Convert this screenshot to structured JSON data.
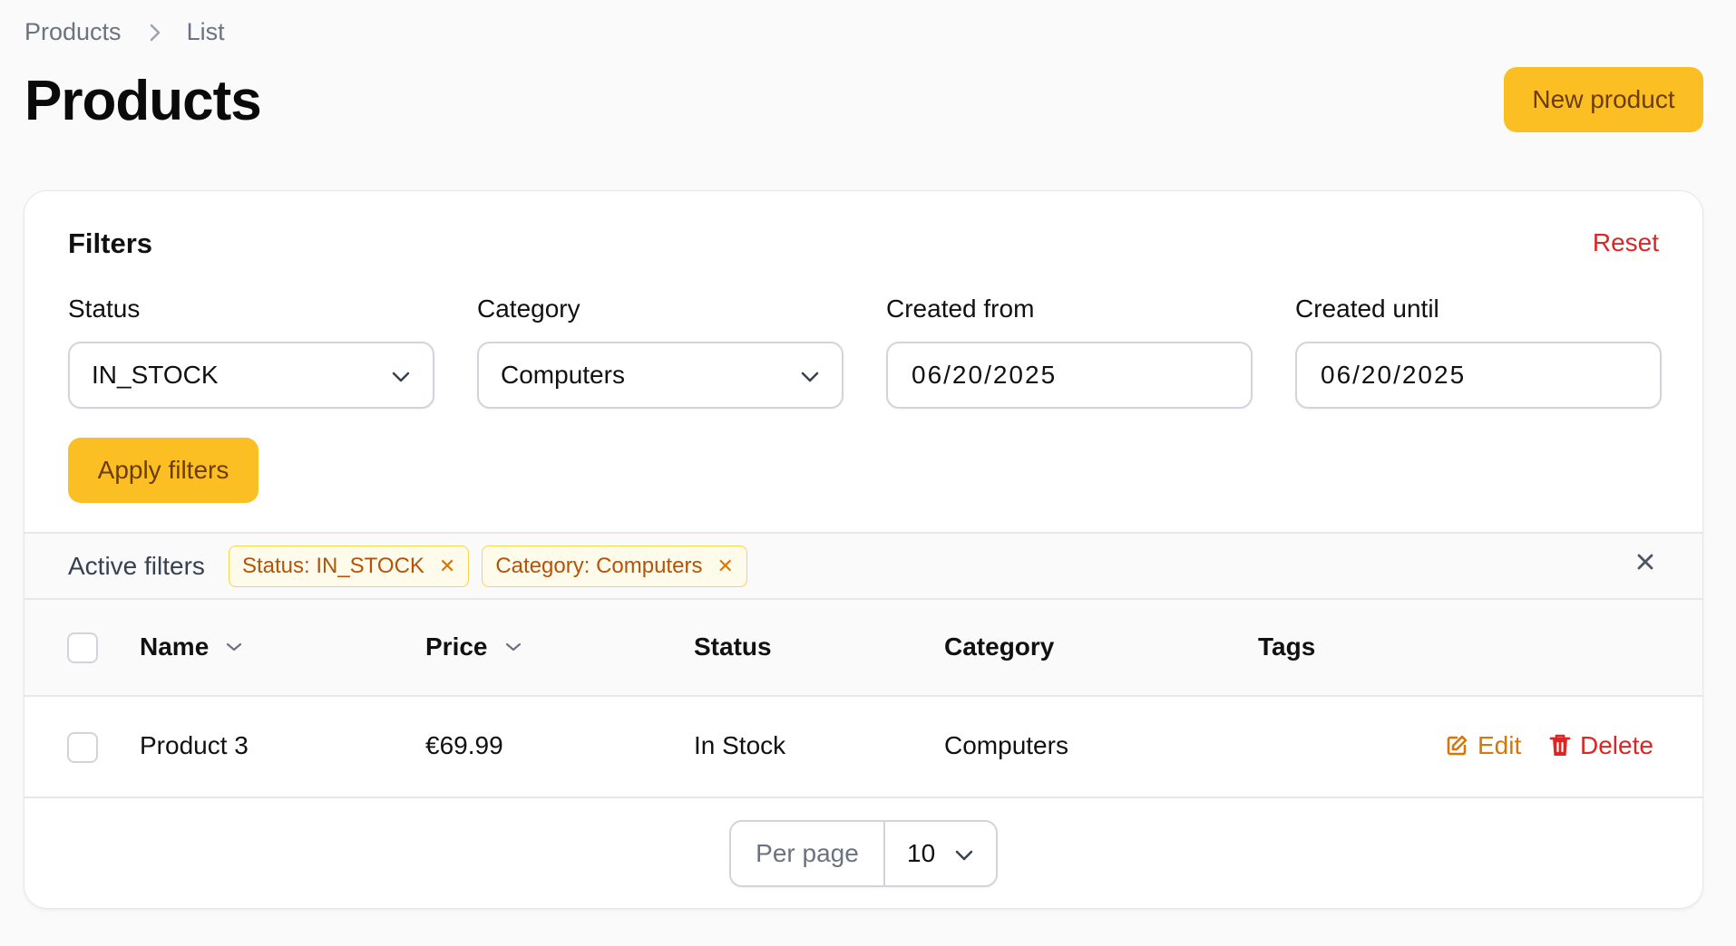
{
  "breadcrumb": {
    "items": [
      "Products",
      "List"
    ]
  },
  "page": {
    "title": "Products",
    "new_button": "New product"
  },
  "filters": {
    "title": "Filters",
    "reset": "Reset",
    "status": {
      "label": "Status",
      "value": "IN_STOCK"
    },
    "category": {
      "label": "Category",
      "value": "Computers"
    },
    "created_from": {
      "label": "Created from",
      "value": "06/20/2025"
    },
    "created_until": {
      "label": "Created until",
      "value": "06/20/2025"
    },
    "apply": "Apply filters"
  },
  "active_filters": {
    "label": "Active filters",
    "chips": [
      "Status: IN_STOCK",
      "Category: Computers"
    ]
  },
  "table": {
    "columns": [
      "Name",
      "Price",
      "Status",
      "Category",
      "Tags"
    ],
    "rows": [
      {
        "name": "Product 3",
        "price": "€69.99",
        "status": "In Stock",
        "category": "Computers",
        "tags": ""
      }
    ],
    "actions": {
      "edit": "Edit",
      "delete": "Delete"
    }
  },
  "pagination": {
    "per_page_label": "Per page",
    "per_page_value": "10"
  },
  "colors": {
    "accent": "#fbbf24",
    "accent_text": "#6b3d05",
    "danger": "#dc2626",
    "edit": "#d97706"
  }
}
